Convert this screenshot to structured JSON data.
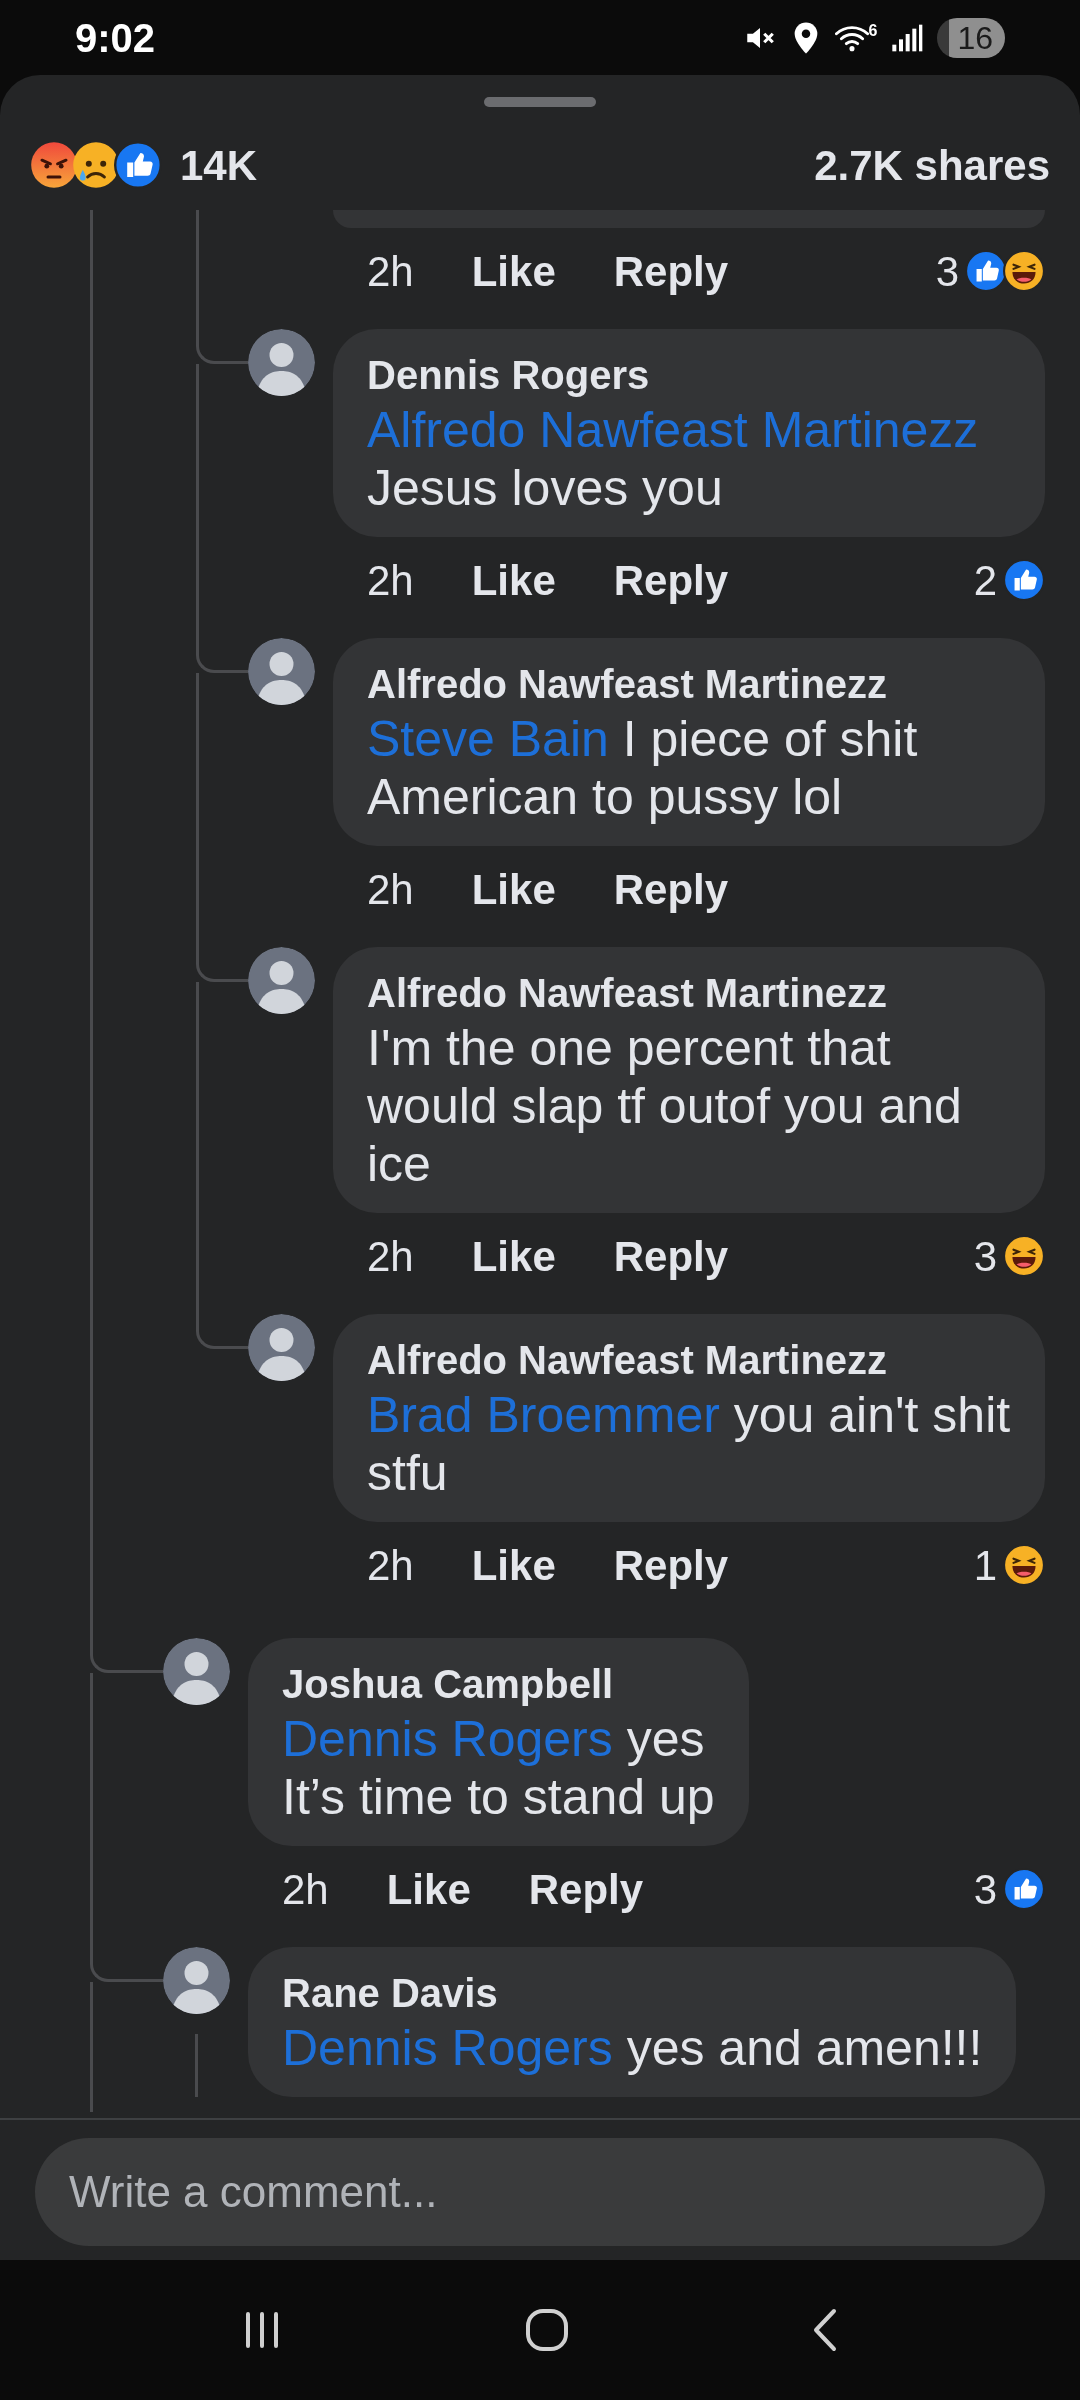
{
  "status_bar": {
    "time": "9:02",
    "wifi_badge": "6",
    "battery": "16"
  },
  "reactions_summary": {
    "reactions": [
      {
        "kind": "angry"
      },
      {
        "kind": "sad"
      },
      {
        "kind": "like"
      }
    ],
    "count": "14K",
    "shares": "2.7K shares"
  },
  "comments": [
    {
      "replies": [
        {
          "kind": "cut",
          "time": "2h",
          "like": "Like",
          "reply": "Reply",
          "reaction_count": "3",
          "reactions": [
            {
              "kind": "like"
            },
            {
              "kind": "haha"
            }
          ]
        },
        {
          "kind": "comment",
          "author": "Dennis Rogers",
          "mention": "Alfredo Nawfeast Martinezz",
          "text": "Jesus loves you",
          "time": "2h",
          "like": "Like",
          "reply": "Reply",
          "reaction_count": "2",
          "reactions": [
            {
              "kind": "like"
            }
          ]
        },
        {
          "kind": "comment",
          "author": "Alfredo Nawfeast Martinezz",
          "mention": "Steve Bain",
          "text": "I piece of shit American to pussy lol",
          "time": "2h",
          "like": "Like",
          "reply": "Reply"
        },
        {
          "kind": "comment",
          "author": "Alfredo Nawfeast Martinezz",
          "text": "I'm the one percent that would slap tf outof you and ice",
          "time": "2h",
          "like": "Like",
          "reply": "Reply",
          "reaction_count": "3",
          "reactions": [
            {
              "kind": "haha"
            }
          ]
        },
        {
          "kind": "comment",
          "author": "Alfredo Nawfeast Martinezz",
          "mention": "Brad Broemmer",
          "text": "you ain't shit stfu",
          "time": "2h",
          "like": "Like",
          "reply": "Reply",
          "reaction_count": "1",
          "reactions": [
            {
              "kind": "haha"
            }
          ]
        }
      ]
    },
    {
      "kind": "comment",
      "author": "Joshua Campbell",
      "mention": "Dennis Rogers",
      "text": "yes\nIt’s time to stand up",
      "time": "2h",
      "like": "Like",
      "reply": "Reply",
      "reaction_count": "3",
      "reactions": [
        {
          "kind": "like"
        }
      ]
    },
    {
      "kind": "comment",
      "author": "Rane Davis",
      "mention": "Dennis Rogers",
      "text": "yes and amen!!!",
      "has_replies": true
    }
  ],
  "composer": {
    "placeholder": "Write a comment..."
  }
}
